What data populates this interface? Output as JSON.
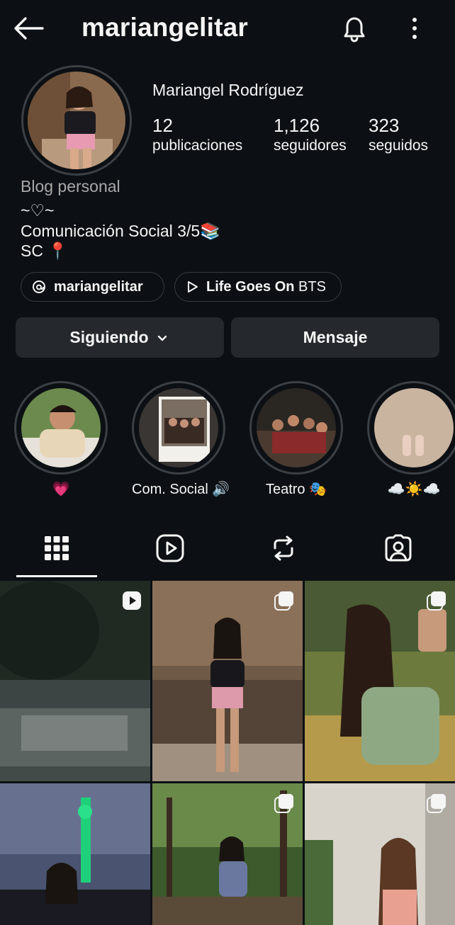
{
  "header": {
    "username": "mariangelitar",
    "icons": [
      "back-arrow-icon",
      "bell-icon",
      "more-vertical-icon"
    ]
  },
  "profile": {
    "full_name": "Mariangel Rodríguez",
    "stats": {
      "posts": {
        "value": "12",
        "label": "publicaciones"
      },
      "followers": {
        "value": "1,126",
        "label": "seguidores"
      },
      "following": {
        "value": "323",
        "label": "seguidos"
      }
    },
    "category": "Blog personal",
    "bio": [
      "~♡~",
      "Comunicación Social 3/5📚",
      "SC 📍"
    ],
    "chips": {
      "threads": {
        "label": "mariangelitar",
        "icon": "threads-icon"
      },
      "music": {
        "label_bold": "Life Goes On",
        "label_rest": " BTS",
        "icon": "play-icon"
      }
    },
    "actions": {
      "following": "Siguiendo",
      "message": "Mensaje"
    }
  },
  "highlights": [
    {
      "label": "💗"
    },
    {
      "label": "Com. Social 🔊"
    },
    {
      "label": "Teatro 🎭"
    },
    {
      "label": "☁️☀️☁️"
    }
  ],
  "tabs": [
    "grid-icon",
    "reels-icon",
    "reposts-icon",
    "tagged-icon"
  ],
  "colors": {
    "background": "#0c1014",
    "button": "#25292e",
    "muted": "#a8a8a8",
    "ring": "#3b4046"
  }
}
